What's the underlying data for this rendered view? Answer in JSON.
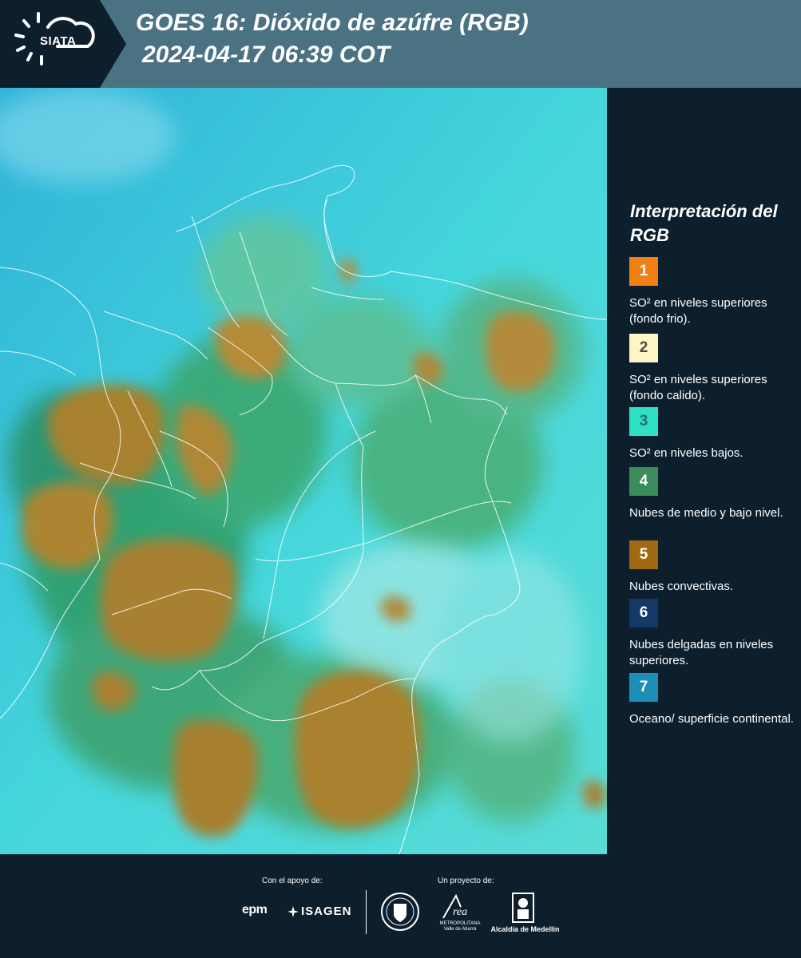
{
  "header": {
    "logo_text": "SIATA",
    "title_line1": "GOES 16: Dióxido de azúfre (RGB)",
    "title_line2": "2024-04-17 06:39 COT",
    "background": "#4a7282",
    "logo_background": "#0d1f2d"
  },
  "legend": {
    "title": "Interpretación del RGB",
    "items": [
      {
        "number": "1",
        "label": "SO² en niveles superiores (fondo frio).",
        "color": "#f07f16",
        "text_color": "#ffffff"
      },
      {
        "number": "2",
        "label": "SO² en niveles superiores (fondo calido).",
        "color": "#fdf6c4",
        "text_color": "#4a4a4a"
      },
      {
        "number": "3",
        "label": "SO² en niveles bajos.",
        "color": "#2ee0c5",
        "text_color": "#2a6c6c"
      },
      {
        "number": "4",
        "label": "Nubes de medio y bajo nivel.",
        "color": "#3a8d5a",
        "text_color": "#ffffff"
      },
      {
        "number": "5",
        "label": "Nubes convectivas.",
        "color": "#9e6b14",
        "text_color": "#ffffff"
      },
      {
        "number": "6",
        "label": "Nubes delgadas en niveles superiores.",
        "color": "#133a66",
        "text_color": "#ffffff"
      },
      {
        "number": "7",
        "label": "Oceano/ superficie continental.",
        "color": "#1c8fb8",
        "text_color": "#ffffff"
      }
    ]
  },
  "map": {
    "ocean_color": "#3fd0de",
    "cloud_color": "#b08a36",
    "mid_cloud_color": "#2e9a62",
    "border_color": "#ffffff",
    "icons": [
      "satellite-map"
    ]
  },
  "footer": {
    "support_label": "Con el apoyo de:",
    "project_label": "Un proyecto de:",
    "epm": "epm",
    "isagen": "ISAGEN",
    "amva_name": "Área",
    "amva_sub": "METROPOLITANA Valle de Aburrá",
    "alcaldia": "Alcaldía de Medellín"
  }
}
